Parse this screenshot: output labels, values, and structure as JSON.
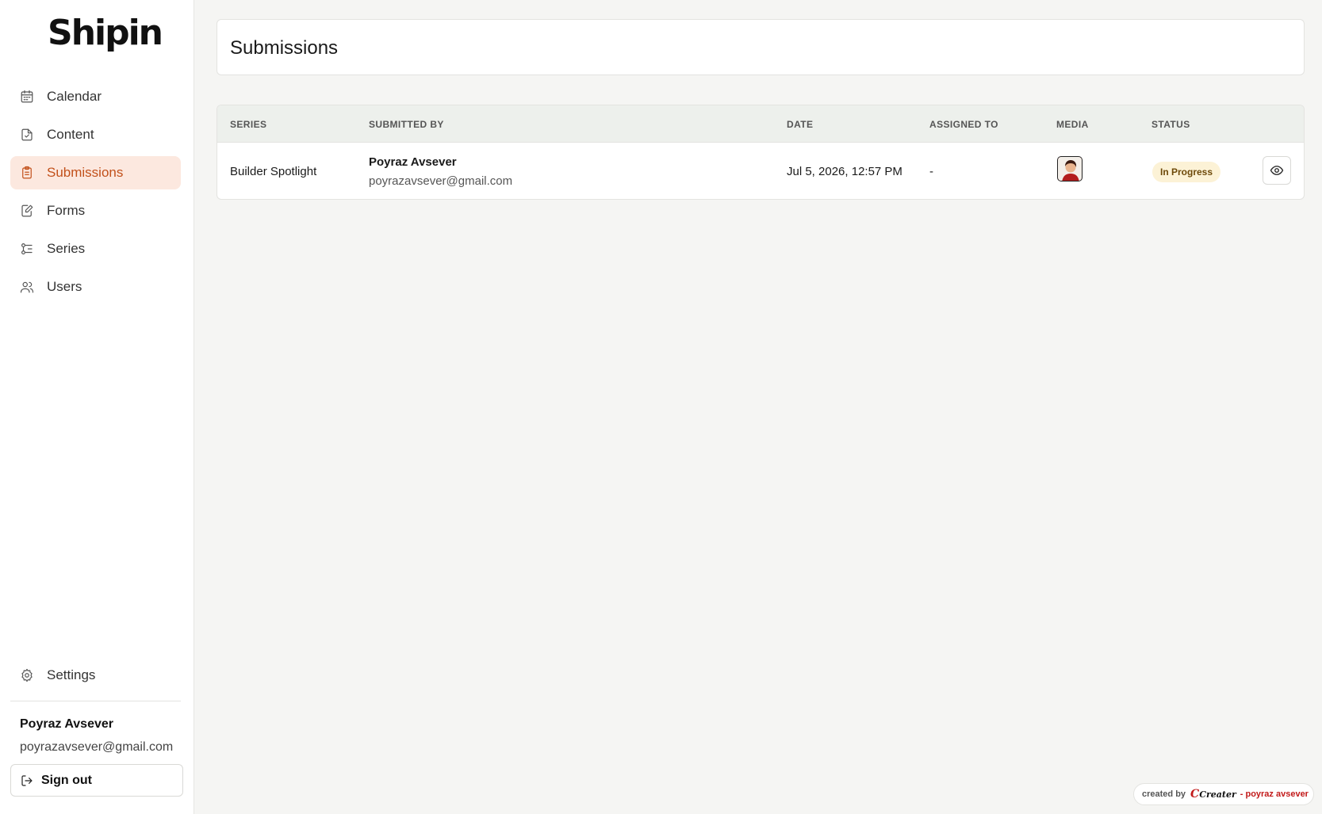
{
  "brand": {
    "name": "Shipin"
  },
  "sidebar": {
    "items": [
      {
        "label": "Calendar",
        "icon": "calendar-icon",
        "active": false
      },
      {
        "label": "Content",
        "icon": "document-icon",
        "active": false
      },
      {
        "label": "Submissions",
        "icon": "clipboard-icon",
        "active": true
      },
      {
        "label": "Forms",
        "icon": "form-edit-icon",
        "active": false
      },
      {
        "label": "Series",
        "icon": "series-icon",
        "active": false
      },
      {
        "label": "Users",
        "icon": "users-icon",
        "active": false
      }
    ],
    "settings_label": "Settings",
    "user": {
      "name": "Poyraz Avsever",
      "email": "poyrazavsever@gmail.com"
    },
    "signout_label": "Sign out"
  },
  "page": {
    "title": "Submissions"
  },
  "table": {
    "columns": [
      "SERIES",
      "SUBMITTED BY",
      "DATE",
      "ASSIGNED TO",
      "MEDIA",
      "STATUS"
    ],
    "rows": [
      {
        "series": "Builder Spotlight",
        "submitter_name": "Poyraz Avsever",
        "submitter_email": "poyrazavsever@gmail.com",
        "date": "Jul 5, 2026, 12:57 PM",
        "assigned_to": "-",
        "status": "In Progress"
      }
    ]
  },
  "credit": {
    "prefix": "created by",
    "logo_text": "Creater",
    "author": "- poyraz avsever"
  },
  "colors": {
    "accent": "#c2501a",
    "active_bg": "#fce8df",
    "status_bg": "#fcf2d6",
    "status_text": "#6e4a0a",
    "header_bg": "#edf0ec"
  }
}
